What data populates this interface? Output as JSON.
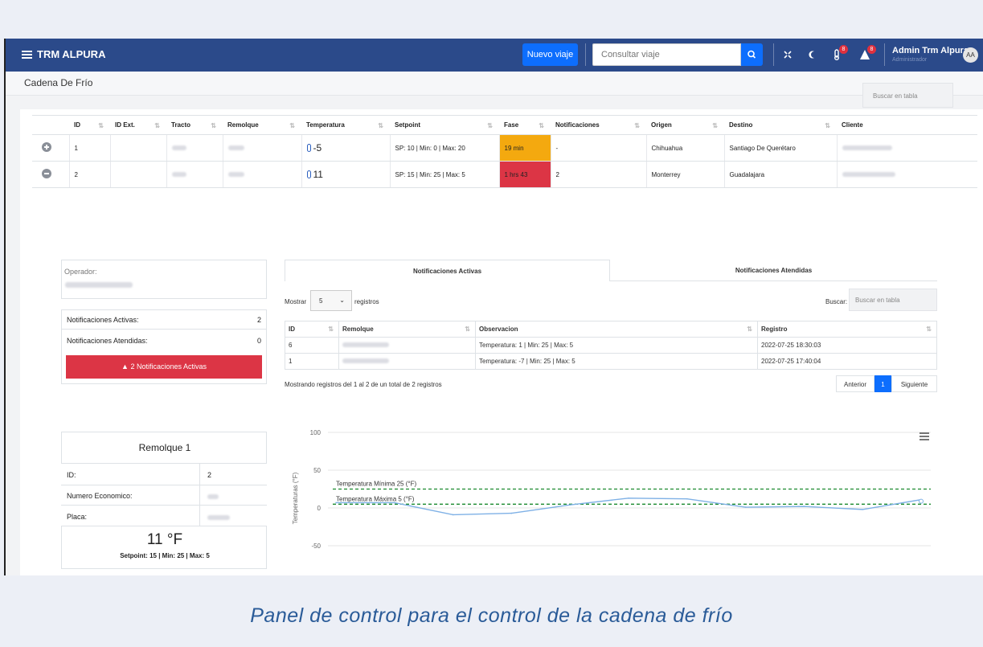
{
  "header": {
    "app_name": "TRM ALPURA",
    "new_trip_label": "Nuevo viaje",
    "search_placeholder": "Consultar viaje",
    "temp_alert_count": "8",
    "alert_count": "8",
    "user_name": "Admin Trm Alpura",
    "user_role": "Administrador",
    "avatar_initials": "AA"
  },
  "page_title": "Cadena De Frío",
  "table_search_placeholder": "Buscar en tabla",
  "main_table": {
    "columns": [
      "ID",
      "ID Ext.",
      "Tracto",
      "Remolque",
      "Temperatura",
      "Setpoint",
      "Fase",
      "Notificaciones",
      "Origen",
      "Destino",
      "Cliente"
    ],
    "rows": [
      {
        "id": "1",
        "id_ext": "",
        "temperatura": "-5",
        "setpoint": "SP: 10 | Min: 0 | Max: 20",
        "fase": "19 min",
        "notificaciones": "-",
        "origen": "Chihuahua",
        "destino": "Santiago De Querétaro"
      },
      {
        "id": "2",
        "id_ext": "",
        "temperatura": "11",
        "setpoint": "SP: 15 | Min: 25 | Max: 5",
        "fase": "1 hrs 43",
        "notificaciones": "2",
        "origen": "Monterrey",
        "destino": "Guadalajara"
      }
    ]
  },
  "detail": {
    "operator_label": "Operador:",
    "active_label": "Notificaciones Activas:",
    "active_value": "2",
    "attended_label": "Notificaciones Atendidas:",
    "attended_value": "0",
    "alert_button": "2 Notificaciones Activas",
    "tabs": [
      "Notificaciones Activas",
      "Notificaciones Atendidas"
    ],
    "show_label": "Mostrar",
    "show_value": "5",
    "records_label": "registros",
    "search_label": "Buscar:",
    "search_placeholder": "Buscar en tabla",
    "notif_columns": [
      "ID",
      "Remolque",
      "Observacion",
      "Registro"
    ],
    "notif_rows": [
      {
        "id": "6",
        "observacion": "Temperatura: 1 | Min: 25 | Max: 5",
        "registro": "2022-07-25 18:30:03"
      },
      {
        "id": "1",
        "observacion": "Temperatura: -7 | Min: 25 | Max: 5",
        "registro": "2022-07-25 17:40:04"
      }
    ],
    "summary": "Mostrando registros del 1 al 2 de un total de 2 registros",
    "pager": {
      "prev": "Anterior",
      "page": "1",
      "next": "Siguiente"
    }
  },
  "trailer": {
    "title": "Remolque 1",
    "id_label": "ID:",
    "id_value": "2",
    "econ_label": "Numero Economico:",
    "plate_label": "Placa:",
    "temperature": "11 °F",
    "setpoint_line": "Setpoint: 15 | Min: 25 | Max: 5"
  },
  "chart_data": {
    "type": "line",
    "ylabel": "Temperaturas (°F)",
    "yticks": [
      100,
      50,
      0,
      -50
    ],
    "ylim": [
      -65,
      100
    ],
    "series": [
      {
        "values": [
          7,
          7,
          -9,
          -7,
          4,
          13,
          12,
          1,
          2,
          -2,
          11
        ],
        "color": "#7fb1e6"
      }
    ],
    "thresholds": [
      {
        "label": "Temperatura Mínima 25 (°F)",
        "value": 25,
        "color": "#1a8a2e"
      },
      {
        "label": "Temperatura Máxima 5 (°F)",
        "value": 5,
        "color": "#1a8a2e"
      }
    ]
  },
  "caption": "Panel de control para el control de la cadena de frío"
}
